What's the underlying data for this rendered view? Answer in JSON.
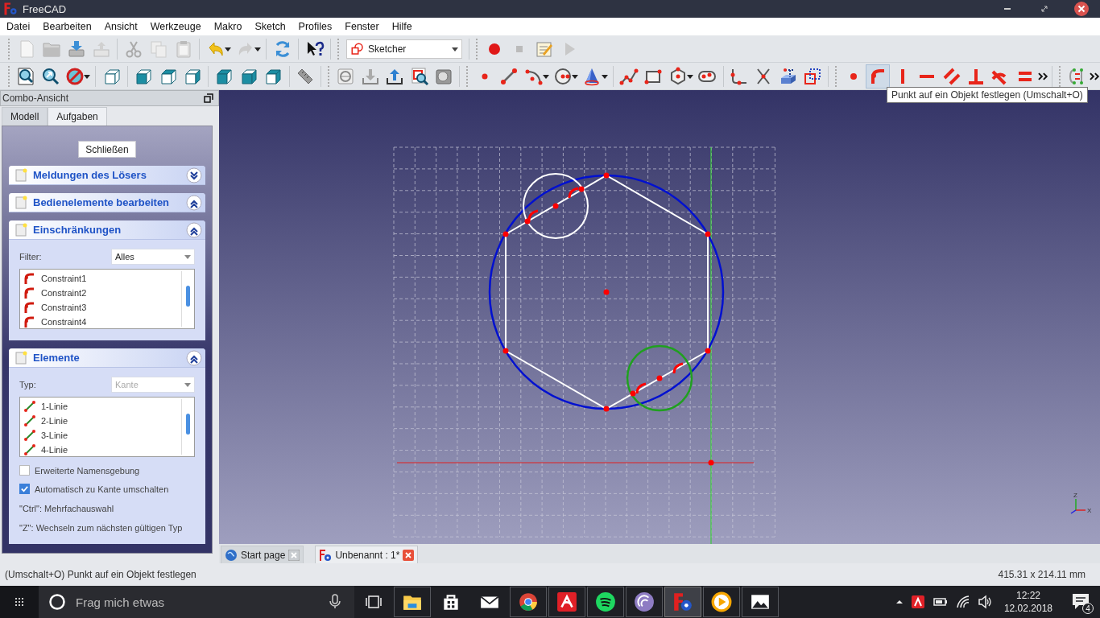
{
  "window": {
    "title": "FreeCAD"
  },
  "menu": [
    "Datei",
    "Bearbeiten",
    "Ansicht",
    "Werkzeuge",
    "Makro",
    "Sketch",
    "Profiles",
    "Fenster",
    "Hilfe"
  ],
  "workbench": {
    "value": "Sketcher"
  },
  "constraint_tools": [
    {
      "kind": "coincident",
      "selected": false
    },
    {
      "kind": "point_on_object",
      "selected": true
    },
    {
      "kind": "vertical",
      "selected": false
    },
    {
      "kind": "horizontal",
      "selected": false
    },
    {
      "kind": "parallel",
      "selected": false
    },
    {
      "kind": "perpendicular",
      "selected": false
    },
    {
      "kind": "tangent",
      "selected": false
    },
    {
      "kind": "equal",
      "selected": false
    }
  ],
  "tooltip": "Punkt auf ein Objekt festlegen (Umschalt+O)",
  "combo_view": {
    "title": "Combo-Ansicht",
    "tabs": [
      {
        "label": "Modell",
        "selected": false
      },
      {
        "label": "Aufgaben",
        "selected": true
      }
    ]
  },
  "task_panel": {
    "close_button": "Schließen",
    "sections": [
      {
        "kind": "plain",
        "title": "Meldungen des Lösers",
        "expanded": false
      },
      {
        "kind": "plain",
        "title": "Bedienelemente bearbeiten",
        "expanded": true
      },
      {
        "kind": "constraints",
        "title": "Einschränkungen",
        "expanded": true,
        "filter_label": "Filter:",
        "filter_value": "Alles",
        "items": [
          "Constraint1",
          "Constraint2",
          "Constraint3",
          "Constraint4"
        ]
      },
      {
        "kind": "elements",
        "title": "Elemente",
        "expanded": true,
        "type_label": "Typ:",
        "type_value": "Kante",
        "type_disabled": true,
        "items": [
          "1-Linie",
          "2-Linie",
          "3-Linie",
          "4-Linie"
        ],
        "checkboxes": [
          {
            "label": "Erweiterte Namensgebung",
            "checked": false
          },
          {
            "label": "Automatisch zu Kante umschalten",
            "checked": true
          }
        ],
        "notes": [
          "\"Ctrl\": Mehrfachauswahl",
          "\"Z\": Wechseln zum nächsten gültigen Typ"
        ]
      }
    ]
  },
  "viewport": {
    "axis_labels": [
      "Z",
      "X"
    ]
  },
  "doc_tabs": [
    {
      "kind": "start",
      "label": "Start page",
      "selected": false
    },
    {
      "kind": "document",
      "label": "Unbenannt : 1*",
      "selected": true
    }
  ],
  "status_bar": {
    "message": "(Umschalt+O) Punkt auf ein Objekt festlegen",
    "dimensions": "415.31 x 214.11 mm"
  },
  "taskbar": {
    "search_placeholder": "Frag mich etwas",
    "apps": [
      {
        "kind": "explorer",
        "running": true,
        "selected": false
      },
      {
        "kind": "store",
        "running": false,
        "selected": false
      },
      {
        "kind": "mail",
        "running": false,
        "selected": false
      },
      {
        "kind": "chrome",
        "running": true,
        "selected": false
      },
      {
        "kind": "avira",
        "running": true,
        "selected": false
      },
      {
        "kind": "spotify",
        "running": true,
        "selected": false
      },
      {
        "kind": "torrent",
        "running": true,
        "selected": false
      },
      {
        "kind": "freecad",
        "running": true,
        "selected": true
      },
      {
        "kind": "player",
        "running": true,
        "selected": false
      },
      {
        "kind": "photos",
        "running": true,
        "selected": false
      }
    ],
    "time": "12:22",
    "date": "12.02.2018",
    "notifications": "4"
  }
}
